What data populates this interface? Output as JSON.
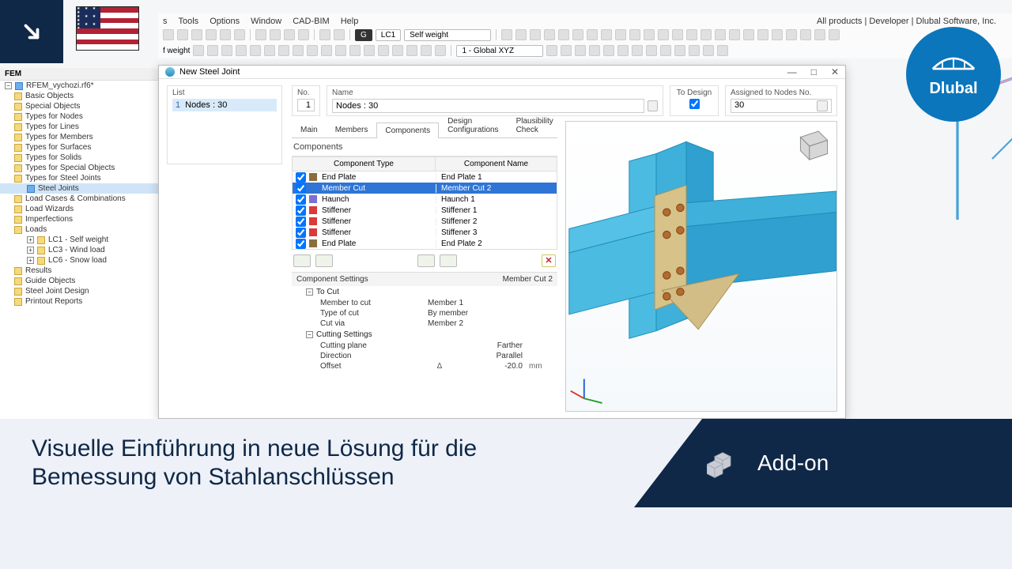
{
  "corner": {
    "arrow": "↘"
  },
  "logo": {
    "name": "Dlubal"
  },
  "menubar": {
    "items": [
      "s",
      "Tools",
      "Options",
      "Window",
      "CAD-BIM",
      "Help"
    ],
    "right": "All products | Developer | Dlubal Software, Inc."
  },
  "toolbar": {
    "lc_code": "LC1",
    "lc_name": "Self weight",
    "lc_box": "G"
  },
  "toolbar2": {
    "label": "f weight",
    "coords": "1 - Global XYZ"
  },
  "side": {
    "title": "FEM"
  },
  "tree": {
    "root": "RFEM_vychozi.rf6*",
    "items": [
      "Basic Objects",
      "Special Objects",
      "Types for Nodes",
      "Types for Lines",
      "Types for Members",
      "Types for Surfaces",
      "Types for Solids",
      "Types for Special Objects",
      "Types for Steel Joints"
    ],
    "steel_joints": "Steel Joints",
    "items2": [
      "Load Cases & Combinations",
      "Load Wizards",
      "Imperfections",
      "Loads"
    ],
    "loads": [
      "LC1 - Self weight",
      "LC3 - Wind load",
      "LC6 - Snow load"
    ],
    "items3": [
      "Results",
      "Guide Objects",
      "Steel Joint Design",
      "Printout Reports"
    ]
  },
  "dialog": {
    "title": "New Steel Joint",
    "list_caption": "List",
    "list_row": {
      "num": "1",
      "text": "Nodes : 30"
    },
    "no_caption": "No.",
    "no_value": "1",
    "name_caption": "Name",
    "name_value": "Nodes : 30",
    "todesign_caption": "To Design",
    "assign_caption": "Assigned to Nodes No.",
    "assign_value": "30",
    "tabs": [
      "Main",
      "Members",
      "Components",
      "Design Configurations",
      "Plausibility Check"
    ],
    "components_title": "Components",
    "col_type": "Component Type",
    "col_name": "Component Name",
    "rows": [
      {
        "sw": "#8c6d3f",
        "type": "End Plate",
        "name": "End Plate 1",
        "sel": false
      },
      {
        "sw": "#2e75d6",
        "type": "Member Cut",
        "name": "Member Cut 2",
        "sel": true
      },
      {
        "sw": "#7b6fd1",
        "type": "Haunch",
        "name": "Haunch 1",
        "sel": false
      },
      {
        "sw": "#d93a3a",
        "type": "Stiffener",
        "name": "Stiffener 1",
        "sel": false
      },
      {
        "sw": "#d93a3a",
        "type": "Stiffener",
        "name": "Stiffener 2",
        "sel": false
      },
      {
        "sw": "#d93a3a",
        "type": "Stiffener",
        "name": "Stiffener 3",
        "sel": false
      },
      {
        "sw": "#8c6d3f",
        "type": "End Plate",
        "name": "End Plate 2",
        "sel": false
      }
    ],
    "settings_title": "Component Settings",
    "settings_for": "Member Cut 2",
    "grp1": "To Cut",
    "grp1_rows": [
      {
        "k": "Member to cut",
        "v": "Member 1"
      },
      {
        "k": "Type of cut",
        "v": "By member"
      },
      {
        "k": "Cut via",
        "v": "Member 2"
      }
    ],
    "grp2": "Cutting Settings",
    "grp2_rows": [
      {
        "k": "Cutting plane",
        "v": "Farther"
      },
      {
        "k": "Direction",
        "v": "Parallel"
      },
      {
        "k": "Offset",
        "d": "Δ",
        "v": "-20.0",
        "u": "mm"
      }
    ]
  },
  "banner": {
    "title": "Visuelle Einführung in neue Lösung für die Bemessung von Stahlanschlüssen",
    "tag": "Add-on"
  }
}
